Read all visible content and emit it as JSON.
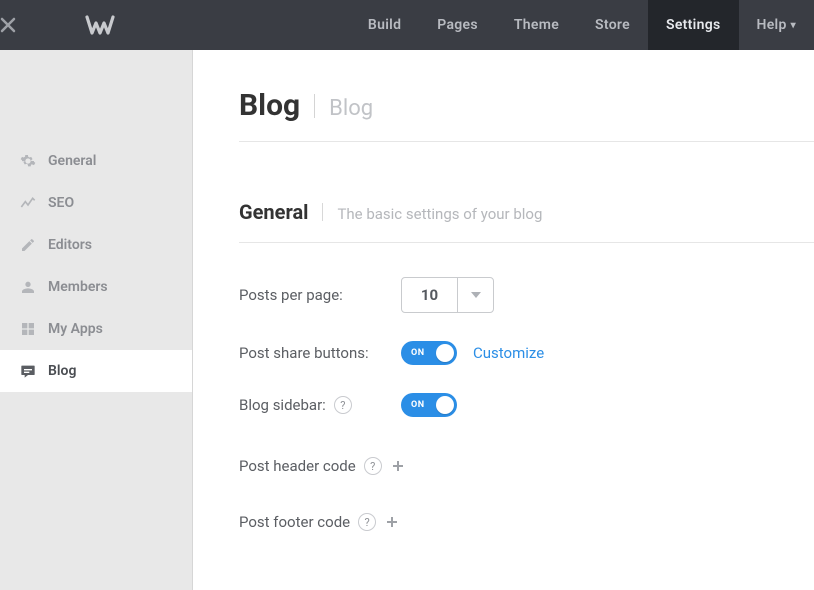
{
  "topnav": {
    "items": [
      {
        "label": "Build"
      },
      {
        "label": "Pages"
      },
      {
        "label": "Theme"
      },
      {
        "label": "Store"
      },
      {
        "label": "Settings",
        "active": true
      },
      {
        "label": "Help"
      }
    ]
  },
  "sidebar": {
    "items": [
      {
        "label": "General"
      },
      {
        "label": "SEO"
      },
      {
        "label": "Editors"
      },
      {
        "label": "Members"
      },
      {
        "label": "My Apps"
      },
      {
        "label": "Blog",
        "active": true
      }
    ]
  },
  "page": {
    "title": "Blog",
    "subtitle": "Blog",
    "section_title": "General",
    "section_desc": "The basic settings of your blog"
  },
  "settings": {
    "posts_per_page": {
      "label": "Posts per page:",
      "value": "10"
    },
    "share_buttons": {
      "label": "Post share buttons:",
      "state": "ON",
      "customize_label": "Customize"
    },
    "blog_sidebar": {
      "label": "Blog sidebar:",
      "state": "ON"
    },
    "header_code": {
      "label": "Post header code"
    },
    "footer_code": {
      "label": "Post footer code"
    }
  }
}
